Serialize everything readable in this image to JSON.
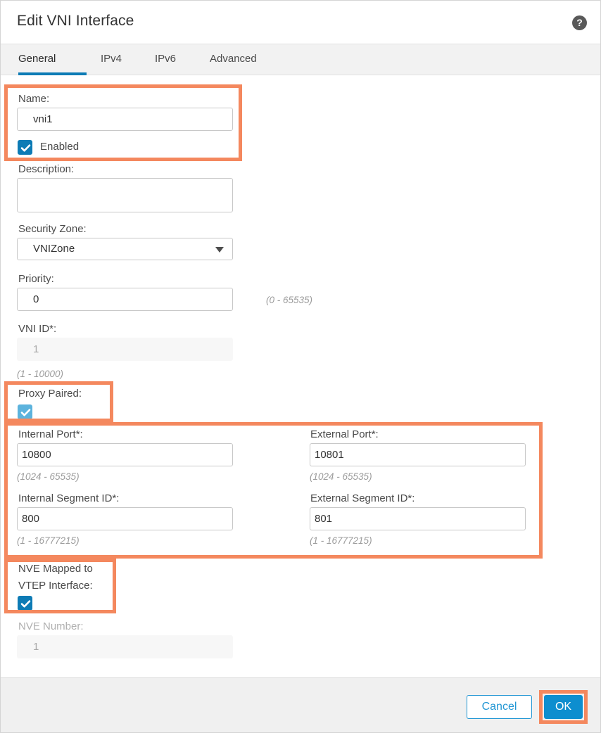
{
  "header": {
    "title": "Edit VNI Interface",
    "help_icon": "help-circle-icon",
    "help_glyph": "?"
  },
  "tabs": [
    {
      "label": "General",
      "active": true
    },
    {
      "label": "IPv4",
      "active": false
    },
    {
      "label": "IPv6",
      "active": false
    },
    {
      "label": "Advanced",
      "active": false
    }
  ],
  "form": {
    "name": {
      "label": "Name:",
      "value": "vni1",
      "placeholder": ""
    },
    "enabled": {
      "label": "Enabled",
      "checked": true
    },
    "description": {
      "label": "Description:",
      "value": "",
      "placeholder": ""
    },
    "security_zone": {
      "label": "Security Zone:",
      "value": "VNIZone",
      "arrow_icon": "chevron-down-icon"
    },
    "priority": {
      "label": "Priority:",
      "value": "0",
      "hint": "(0 - 65535)"
    },
    "vni_id": {
      "label": "VNI ID*:",
      "value": "1",
      "hint": "(1 - 10000)",
      "disabled": true
    },
    "proxy_paired": {
      "label": "Proxy Paired:",
      "checked": true
    },
    "internal_port": {
      "label": "Internal Port*:",
      "value": "10800",
      "hint": "(1024 - 65535)"
    },
    "external_port": {
      "label": "External Port*:",
      "value": "10801",
      "hint": "(1024 - 65535)"
    },
    "internal_segment_id": {
      "label": "Internal Segment ID*:",
      "value": "800",
      "hint": "(1 - 16777215)"
    },
    "external_segment_id": {
      "label": "External Segment ID*:",
      "value": "801",
      "hint": "(1 - 16777215)"
    },
    "nve_mapped": {
      "label_line1": "NVE Mapped to",
      "label_line2": "VTEP Interface:",
      "checked": true
    },
    "nve_number": {
      "label": "NVE Number:",
      "value": "1",
      "disabled": true
    }
  },
  "footer": {
    "cancel_label": "Cancel",
    "ok_label": "OK"
  },
  "colors": {
    "accent_blue": "#0d7bb5",
    "button_blue": "#0d8ecf",
    "link_blue": "#2196d4",
    "highlight_orange": "#f4885e",
    "checkbox_light_blue": "#5cb3dd",
    "footer_gray": "#f0f0f0",
    "tabbar_gray": "#f2f2f2"
  }
}
